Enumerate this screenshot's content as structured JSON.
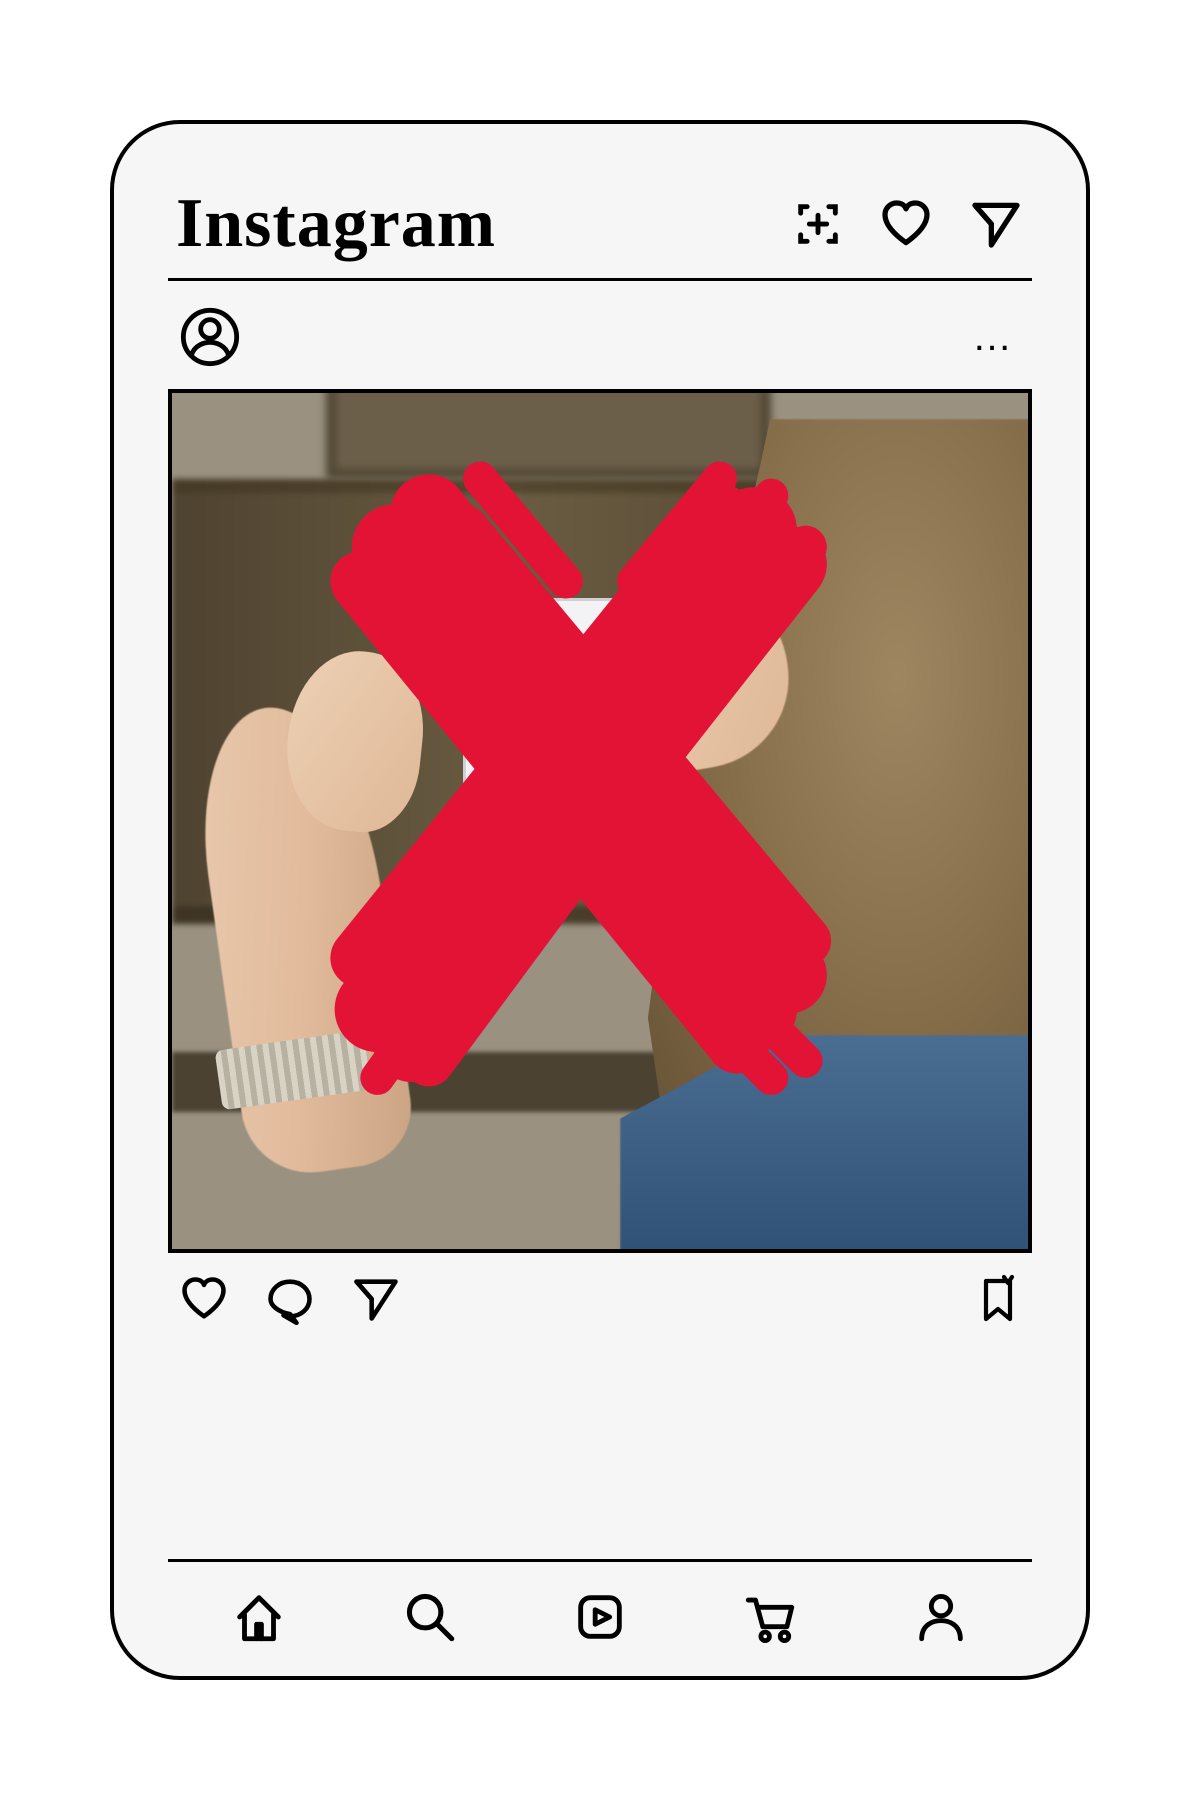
{
  "header": {
    "logo_text": "Instagram",
    "icons": {
      "new_post": "new-post-icon",
      "activity": "heart-icon",
      "messages": "send-icon"
    }
  },
  "post": {
    "avatar": "profile-icon",
    "more": "…",
    "image_alt": "Person photographing artwork in a museum with a large red X drawn over the image",
    "overlay": {
      "mark": "X",
      "color": "#e31336"
    },
    "actions": {
      "like": "heart-icon",
      "comment": "comment-icon",
      "share": "send-icon",
      "save": "bookmark-icon"
    }
  },
  "nav": {
    "home": "home-icon",
    "search": "search-icon",
    "reels": "reels-icon",
    "shop": "cart-icon",
    "profile": "person-icon"
  },
  "colors": {
    "stroke": "#000000",
    "bg_device": "#f6f6f6",
    "overlay_red": "#e31336"
  }
}
